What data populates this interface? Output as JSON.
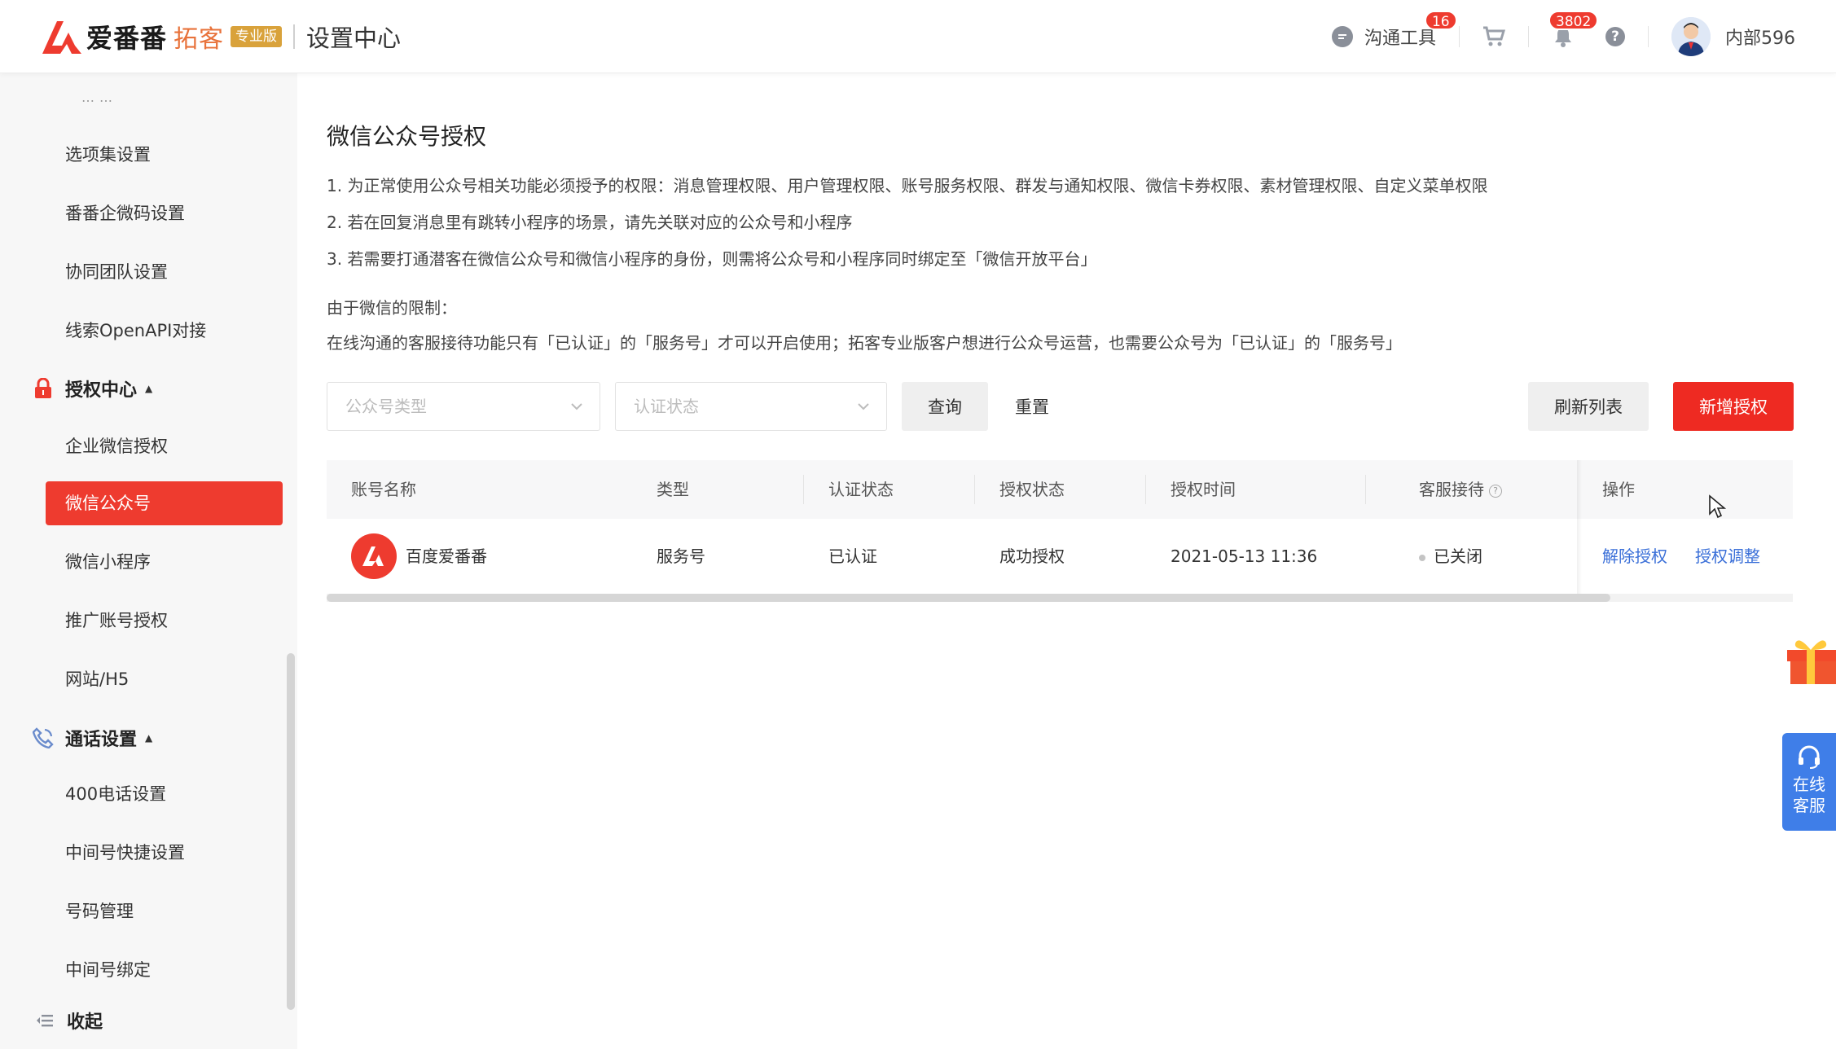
{
  "header": {
    "brand_main": "爱番番",
    "brand_sub": "拓客",
    "brand_badge": "专业版",
    "section_title": "设置中心",
    "tools_label": "沟通工具",
    "tools_badge": "16",
    "notify_badge": "3802",
    "help_glyph": "?",
    "user_name": "内部596"
  },
  "sidebar": {
    "cut_item": "……",
    "items_top": [
      "选项集设置",
      "番番企微码设置",
      "协同团队设置",
      "线索OpenAPI对接"
    ],
    "group_auth": "授权中心",
    "auth_items": [
      "企业微信授权",
      "微信公众号",
      "微信小程序",
      "推广账号授权",
      "网站/H5"
    ],
    "group_call": "通话设置",
    "call_items": [
      "400电话设置",
      "中间号快捷设置",
      "号码管理",
      "中间号绑定"
    ],
    "collapse_label": "收起"
  },
  "main": {
    "title": "微信公众号授权",
    "notes": [
      "1. 为正常使用公众号相关功能必须授予的权限：消息管理权限、用户管理权限、账号服务权限、群发与通知权限、微信卡券权限、素材管理权限、自定义菜单权限",
      "2. 若在回复消息里有跳转小程序的场景，请先关联对应的公众号和小程序",
      "3. 若需要打通潜客在微信公众号和微信小程序的身份，则需将公众号和小程序同时绑定至「微信开放平台」"
    ],
    "limit_title": "由于微信的限制：",
    "limit_text": "在线沟通的客服接待功能只有「已认证」的「服务号」才可以开启使用；拓客专业版客户想进行公众号运营，也需要公众号为「已认证」的「服务号」",
    "filters": {
      "type_placeholder": "公众号类型",
      "status_placeholder": "认证状态",
      "query_label": "查询",
      "reset_label": "重置",
      "refresh_label": "刷新列表",
      "add_label": "新增授权"
    },
    "table": {
      "columns": [
        "账号名称",
        "类型",
        "认证状态",
        "授权状态",
        "授权时间",
        "客服接待",
        "操作"
      ],
      "rows": [
        {
          "name": "百度爱番番",
          "type": "服务号",
          "verify": "已认证",
          "auth": "成功授权",
          "time": "2021-05-13 11:36",
          "service": "已关闭",
          "action_revoke": "解除授权",
          "action_adjust": "授权调整"
        }
      ]
    }
  },
  "float": {
    "service_label_1": "在线",
    "service_label_2": "客服"
  },
  "colors": {
    "accent": "#ee3b2f",
    "link": "#3a6fd8",
    "service": "#3f7ee8"
  }
}
